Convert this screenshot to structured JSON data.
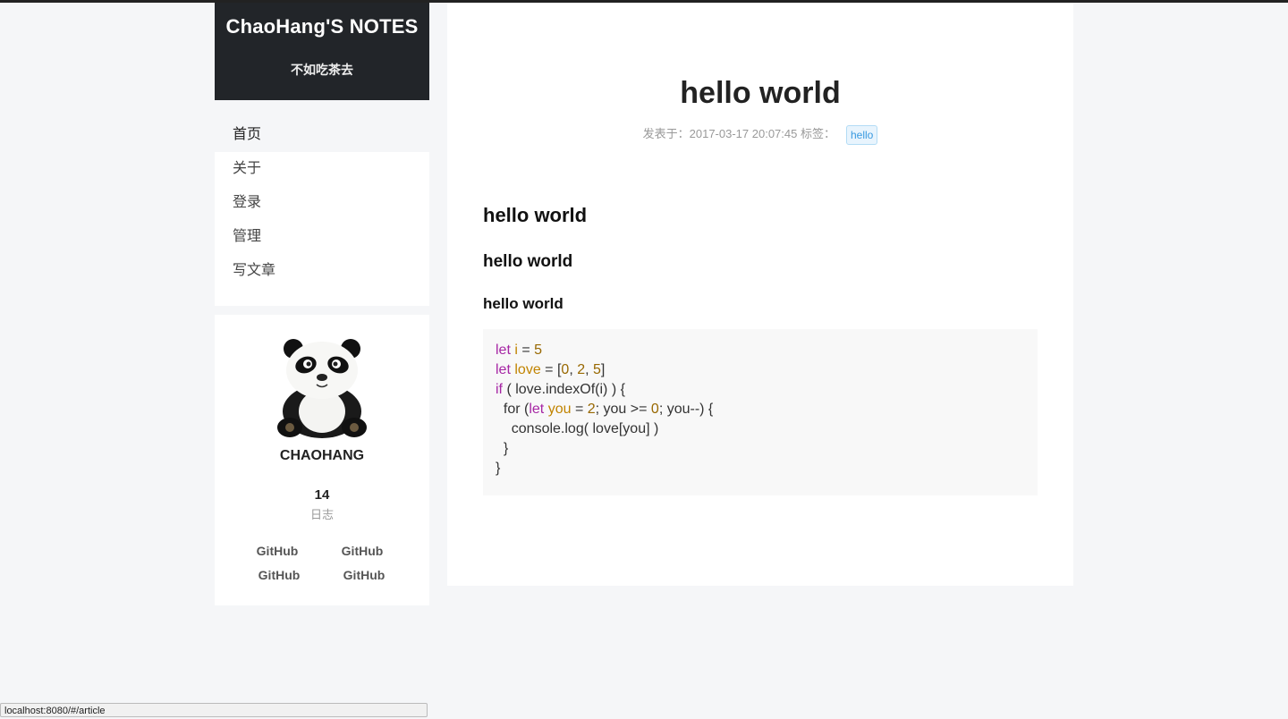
{
  "site": {
    "title": "ChaoHang'S NOTES",
    "subtitle": "不如吃茶去"
  },
  "nav": {
    "items": [
      {
        "label": "首页",
        "active": true
      },
      {
        "label": "关于",
        "active": false
      },
      {
        "label": "登录",
        "active": false
      },
      {
        "label": "管理",
        "active": false
      },
      {
        "label": "写文章",
        "active": false
      }
    ]
  },
  "profile": {
    "name": "CHAOHANG",
    "post_count": "14",
    "post_label": "日志",
    "links": [
      "GitHub",
      "GitHub",
      "GitHub",
      "GitHub"
    ],
    "avatar_icon": "panda-avatar"
  },
  "article": {
    "title": "hello world",
    "meta_prefix": "发表于：",
    "date": "2017-03-17 20:07:45",
    "tags_label": "标签：",
    "tags": [
      "hello"
    ],
    "headings": [
      "hello world",
      "hello world",
      "hello world"
    ],
    "code": [
      [
        {
          "t": "let",
          "c": "kw"
        },
        {
          "t": " "
        },
        {
          "t": "i",
          "c": "var"
        },
        {
          "t": " = "
        },
        {
          "t": "5",
          "c": "num"
        }
      ],
      [
        {
          "t": "let",
          "c": "kw"
        },
        {
          "t": " "
        },
        {
          "t": "love",
          "c": "var"
        },
        {
          "t": " = ["
        },
        {
          "t": "0",
          "c": "num"
        },
        {
          "t": ", "
        },
        {
          "t": "2",
          "c": "num"
        },
        {
          "t": ", "
        },
        {
          "t": "5",
          "c": "num"
        },
        {
          "t": "]"
        }
      ],
      [
        {
          "t": "if",
          "c": "kw"
        },
        {
          "t": " ( love.indexOf(i) ) {"
        }
      ],
      [
        {
          "t": "  for ("
        },
        {
          "t": "let",
          "c": "kw"
        },
        {
          "t": " "
        },
        {
          "t": "you",
          "c": "var"
        },
        {
          "t": " = "
        },
        {
          "t": "2",
          "c": "num"
        },
        {
          "t": "; you >= "
        },
        {
          "t": "0",
          "c": "num"
        },
        {
          "t": "; you--) {"
        }
      ],
      [
        {
          "t": "    console.log( love[you] )"
        }
      ],
      [
        {
          "t": "  }"
        }
      ],
      [
        {
          "t": "}"
        }
      ]
    ]
  },
  "status_bar": {
    "url": "localhost:8080/#/article"
  },
  "colors": {
    "header_bg": "#222529",
    "page_bg": "#f5f6f8",
    "tag_text": "#3a9ae0",
    "keyword": "#a626a4",
    "variable": "#c18401"
  }
}
